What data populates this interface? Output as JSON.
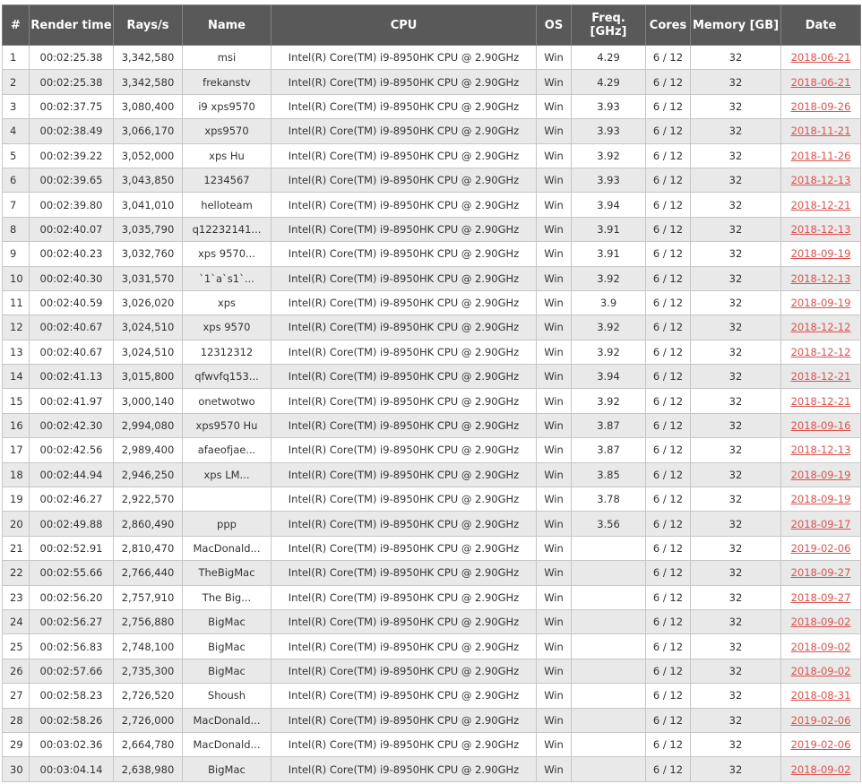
{
  "table": {
    "headers": [
      "#",
      "Render time",
      "Rays/s",
      "Name",
      "CPU",
      "OS",
      "Freq. [GHz]",
      "Cores",
      "Memory [GB]",
      "Date"
    ],
    "rows": [
      [
        "1",
        "00:02:25.38",
        "3,342,580",
        "msi",
        "Intel(R) Core(TM) i9-8950HK CPU @ 2.90GHz",
        "Win",
        "4.29",
        "6 / 12",
        "32",
        "2018-06-21"
      ],
      [
        "2",
        "00:02:25.38",
        "3,342,580",
        "frekanstv",
        "Intel(R) Core(TM) i9-8950HK CPU @ 2.90GHz",
        "Win",
        "4.29",
        "6 / 12",
        "32",
        "2018-06-21"
      ],
      [
        "3",
        "00:02:37.75",
        "3,080,400",
        "i9 xps9570",
        "Intel(R) Core(TM) i9-8950HK CPU @ 2.90GHz",
        "Win",
        "3.93",
        "6 / 12",
        "32",
        "2018-09-26"
      ],
      [
        "4",
        "00:02:38.49",
        "3,066,170",
        "xps9570",
        "Intel(R) Core(TM) i9-8950HK CPU @ 2.90GHz",
        "Win",
        "3.93",
        "6 / 12",
        "32",
        "2018-11-21"
      ],
      [
        "5",
        "00:02:39.22",
        "3,052,000",
        "xps Hu",
        "Intel(R) Core(TM) i9-8950HK CPU @ 2.90GHz",
        "Win",
        "3.92",
        "6 / 12",
        "32",
        "2018-11-26"
      ],
      [
        "6",
        "00:02:39.65",
        "3,043,850",
        "1234567",
        "Intel(R) Core(TM) i9-8950HK CPU @ 2.90GHz",
        "Win",
        "3.93",
        "6 / 12",
        "32",
        "2018-12-13"
      ],
      [
        "7",
        "00:02:39.80",
        "3,041,010",
        "helloteam",
        "Intel(R) Core(TM) i9-8950HK CPU @ 2.90GHz",
        "Win",
        "3.94",
        "6 / 12",
        "32",
        "2018-12-21"
      ],
      [
        "8",
        "00:02:40.07",
        "3,035,790",
        "q12232141...",
        "Intel(R) Core(TM) i9-8950HK CPU @ 2.90GHz",
        "Win",
        "3.91",
        "6 / 12",
        "32",
        "2018-12-13"
      ],
      [
        "9",
        "00:02:40.23",
        "3,032,760",
        "xps 9570...",
        "Intel(R) Core(TM) i9-8950HK CPU @ 2.90GHz",
        "Win",
        "3.91",
        "6 / 12",
        "32",
        "2018-09-19"
      ],
      [
        "10",
        "00:02:40.30",
        "3,031,570",
        "`1`a`s1`...",
        "Intel(R) Core(TM) i9-8950HK CPU @ 2.90GHz",
        "Win",
        "3.92",
        "6 / 12",
        "32",
        "2018-12-13"
      ],
      [
        "11",
        "00:02:40.59",
        "3,026,020",
        "xps",
        "Intel(R) Core(TM) i9-8950HK CPU @ 2.90GHz",
        "Win",
        "3.9",
        "6 / 12",
        "32",
        "2018-09-19"
      ],
      [
        "12",
        "00:02:40.67",
        "3,024,510",
        "xps 9570",
        "Intel(R) Core(TM) i9-8950HK CPU @ 2.90GHz",
        "Win",
        "3.92",
        "6 / 12",
        "32",
        "2018-12-12"
      ],
      [
        "13",
        "00:02:40.67",
        "3,024,510",
        "12312312",
        "Intel(R) Core(TM) i9-8950HK CPU @ 2.90GHz",
        "Win",
        "3.92",
        "6 / 12",
        "32",
        "2018-12-12"
      ],
      [
        "14",
        "00:02:41.13",
        "3,015,800",
        "qfwvfq153...",
        "Intel(R) Core(TM) i9-8950HK CPU @ 2.90GHz",
        "Win",
        "3.94",
        "6 / 12",
        "32",
        "2018-12-21"
      ],
      [
        "15",
        "00:02:41.97",
        "3,000,140",
        "onetwotwo",
        "Intel(R) Core(TM) i9-8950HK CPU @ 2.90GHz",
        "Win",
        "3.92",
        "6 / 12",
        "32",
        "2018-12-21"
      ],
      [
        "16",
        "00:02:42.30",
        "2,994,080",
        "xps9570 Hu",
        "Intel(R) Core(TM) i9-8950HK CPU @ 2.90GHz",
        "Win",
        "3.87",
        "6 / 12",
        "32",
        "2018-09-16"
      ],
      [
        "17",
        "00:02:42.56",
        "2,989,400",
        "afaeofjae...",
        "Intel(R) Core(TM) i9-8950HK CPU @ 2.90GHz",
        "Win",
        "3.87",
        "6 / 12",
        "32",
        "2018-12-13"
      ],
      [
        "18",
        "00:02:44.94",
        "2,946,250",
        "xps LM...",
        "Intel(R) Core(TM) i9-8950HK CPU @ 2.90GHz",
        "Win",
        "3.85",
        "6 / 12",
        "32",
        "2018-09-19"
      ],
      [
        "19",
        "00:02:46.27",
        "2,922,570",
        "",
        "Intel(R) Core(TM) i9-8950HK CPU @ 2.90GHz",
        "Win",
        "3.78",
        "6 / 12",
        "32",
        "2018-09-19"
      ],
      [
        "20",
        "00:02:49.88",
        "2,860,490",
        "ppp",
        "Intel(R) Core(TM) i9-8950HK CPU @ 2.90GHz",
        "Win",
        "3.56",
        "6 / 12",
        "32",
        "2018-09-17"
      ],
      [
        "21",
        "00:02:52.91",
        "2,810,470",
        "MacDonald...",
        "Intel(R) Core(TM) i9-8950HK CPU @ 2.90GHz",
        "Win",
        "",
        "6 / 12",
        "32",
        "2019-02-06"
      ],
      [
        "22",
        "00:02:55.66",
        "2,766,440",
        "TheBigMac",
        "Intel(R) Core(TM) i9-8950HK CPU @ 2.90GHz",
        "Win",
        "",
        "6 / 12",
        "32",
        "2018-09-27"
      ],
      [
        "23",
        "00:02:56.20",
        "2,757,910",
        "The Big...",
        "Intel(R) Core(TM) i9-8950HK CPU @ 2.90GHz",
        "Win",
        "",
        "6 / 12",
        "32",
        "2018-09-27"
      ],
      [
        "24",
        "00:02:56.27",
        "2,756,880",
        "BigMac",
        "Intel(R) Core(TM) i9-8950HK CPU @ 2.90GHz",
        "Win",
        "",
        "6 / 12",
        "32",
        "2018-09-02"
      ],
      [
        "25",
        "00:02:56.83",
        "2,748,100",
        "BigMac",
        "Intel(R) Core(TM) i9-8950HK CPU @ 2.90GHz",
        "Win",
        "",
        "6 / 12",
        "32",
        "2018-09-02"
      ],
      [
        "26",
        "00:02:57.66",
        "2,735,300",
        "BigMac",
        "Intel(R) Core(TM) i9-8950HK CPU @ 2.90GHz",
        "Win",
        "",
        "6 / 12",
        "32",
        "2018-09-02"
      ],
      [
        "27",
        "00:02:58.23",
        "2,726,520",
        "Shoush",
        "Intel(R) Core(TM) i9-8950HK CPU @ 2.90GHz",
        "Win",
        "",
        "6 / 12",
        "32",
        "2018-08-31"
      ],
      [
        "28",
        "00:02:58.26",
        "2,726,000",
        "MacDonald...",
        "Intel(R) Core(TM) i9-8950HK CPU @ 2.90GHz",
        "Win",
        "",
        "6 / 12",
        "32",
        "2019-02-06"
      ],
      [
        "29",
        "00:03:02.36",
        "2,664,780",
        "MacDonald...",
        "Intel(R) Core(TM) i9-8950HK CPU @ 2.90GHz",
        "Win",
        "",
        "6 / 12",
        "32",
        "2019-02-06"
      ],
      [
        "30",
        "00:03:04.14",
        "2,638,980",
        "BigMac",
        "Intel(R) Core(TM) i9-8950HK CPU @ 2.90GHz",
        "Win",
        "",
        "6 / 12",
        "32",
        "2018-09-02"
      ]
    ]
  }
}
